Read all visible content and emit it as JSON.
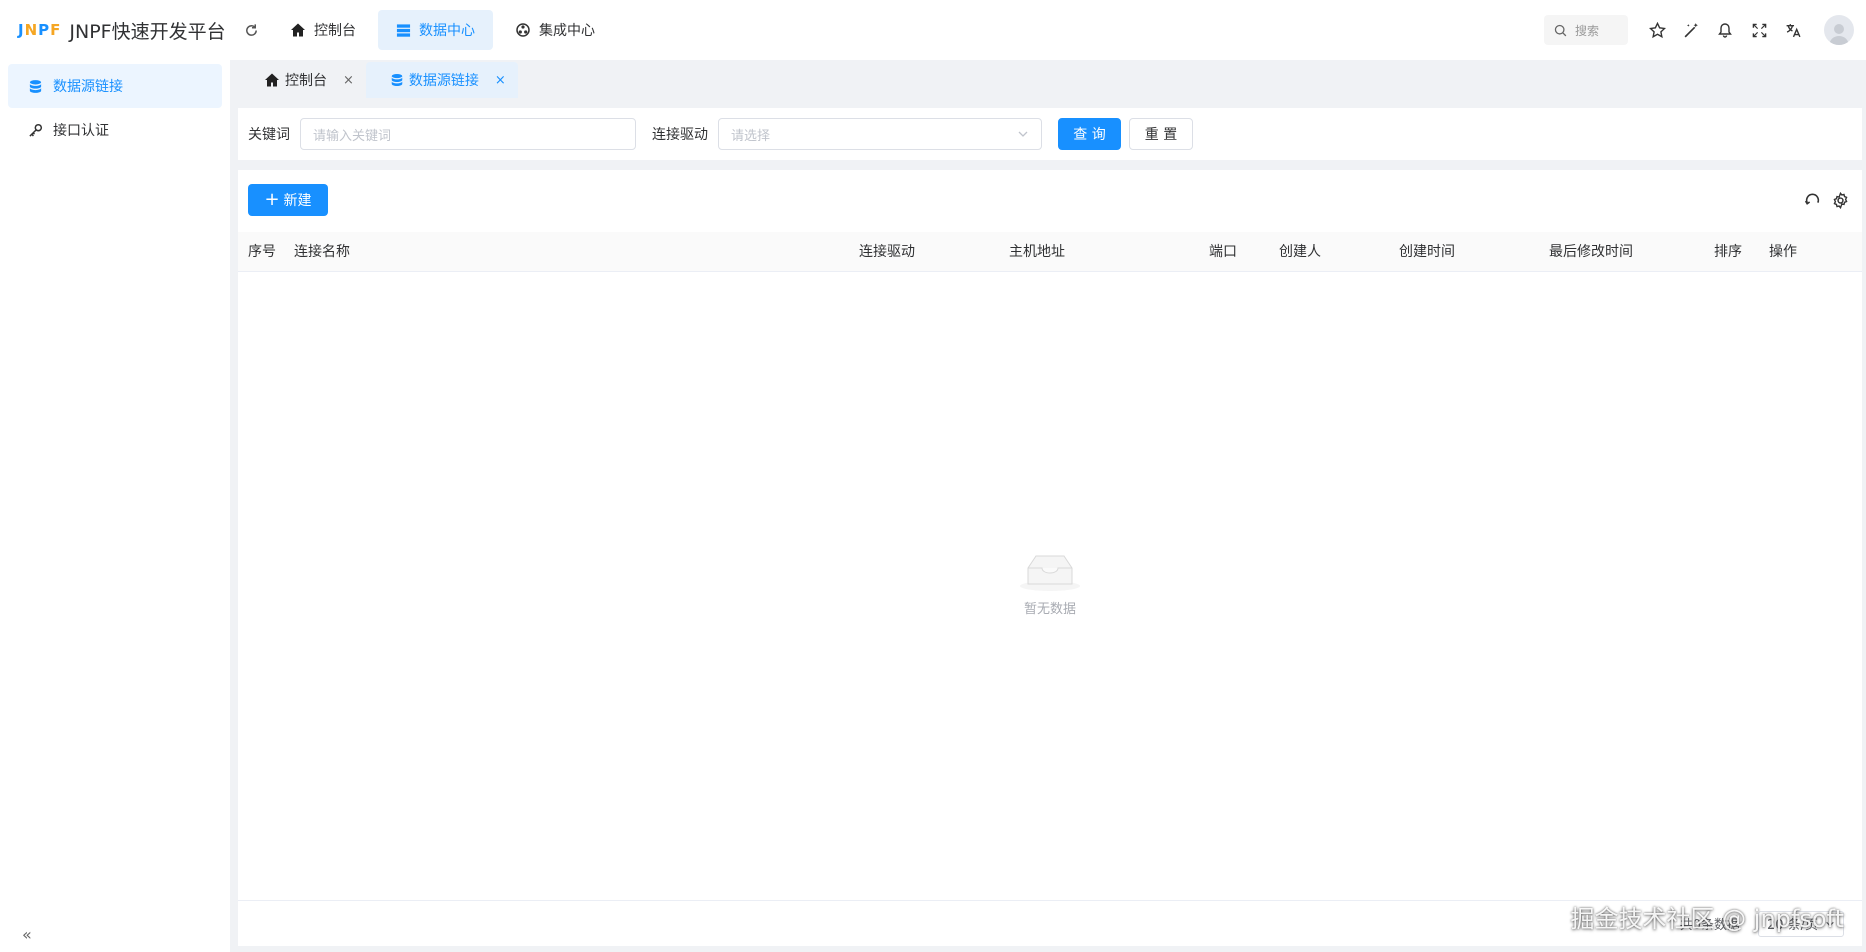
{
  "app": {
    "logo_mark": [
      "J",
      "N",
      "P",
      "F"
    ],
    "title": "JNPF快速开发平台"
  },
  "top_nav": [
    {
      "label": "控制台",
      "icon": "home-icon",
      "active": false
    },
    {
      "label": "数据中心",
      "icon": "database-table-icon",
      "active": true
    },
    {
      "label": "集成中心",
      "icon": "integration-icon",
      "active": false
    }
  ],
  "header": {
    "search_placeholder": "搜索"
  },
  "sidebar": {
    "items": [
      {
        "label": "数据源链接",
        "icon": "database-icon",
        "active": true
      },
      {
        "label": "接口认证",
        "icon": "key-icon",
        "active": false
      }
    ],
    "collapse_glyph": "«"
  },
  "tabs": [
    {
      "label": "控制台",
      "icon": "home-icon",
      "close": "×",
      "active": false
    },
    {
      "label": "数据源链接",
      "icon": "database-icon",
      "close": "×",
      "active": true
    }
  ],
  "filters": {
    "keyword_label": "关键词",
    "keyword_placeholder": "请输入关键词",
    "driver_label": "连接驱动",
    "driver_placeholder": "请选择",
    "query_button": "查 询",
    "reset_button": "重 置"
  },
  "toolbar": {
    "new_button": "新建",
    "new_plus": "+"
  },
  "table": {
    "columns": [
      "序号",
      "连接名称",
      "连接驱动",
      "主机地址",
      "端口",
      "创建人",
      "创建时间",
      "最后修改时间",
      "排序",
      "操作"
    ],
    "rows": [],
    "empty_text": "暂无数据"
  },
  "pagination": {
    "total_text": "共0条数据",
    "page_size": "20 条/页"
  },
  "watermark": "掘金技术社区 @ jnpfsoft",
  "colors": {
    "primary": "#1890ff",
    "active_bg": "#e6f1fc",
    "page_bg": "#f0f2f5"
  }
}
